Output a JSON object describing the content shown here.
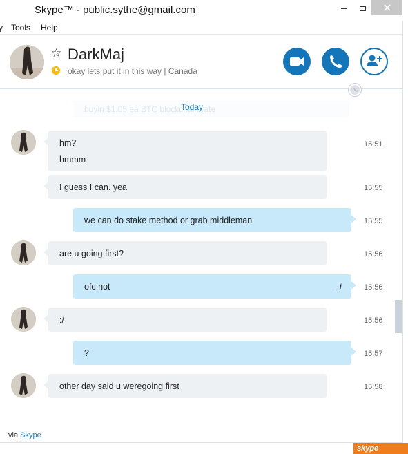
{
  "window": {
    "title": "Skype™ - public.sythe@gmail.com"
  },
  "menu": {
    "items": [
      "Tools",
      "Help"
    ]
  },
  "contact": {
    "name": "DarkMaj",
    "mood": "okay lets put it in this way",
    "location": "Canada",
    "mood_line": "okay lets put it in this way  |  Canada"
  },
  "header_buttons": {
    "video": "video-call",
    "call": "voice-call",
    "add": "add-contact"
  },
  "chat": {
    "ghost_message": "buyin $1.05 ea BTC blockchain rate",
    "date_divider": "Today",
    "messages": [
      {
        "direction": "in",
        "lines": [
          "hm?",
          "hmmm"
        ],
        "time": "15:51",
        "avatar": true
      },
      {
        "direction": "in",
        "lines": [
          "I guess I can. yea"
        ],
        "time": "15:55",
        "avatar": false
      },
      {
        "direction": "out",
        "lines": [
          "we can do stake method or grab middleman"
        ],
        "time": "15:55"
      },
      {
        "direction": "in",
        "lines": [
          "are u going first?"
        ],
        "time": "15:56",
        "avatar": true
      },
      {
        "direction": "out",
        "lines": [
          "ofc not"
        ],
        "time": "15:56",
        "edited": true
      },
      {
        "direction": "in",
        "lines": [
          ":/"
        ],
        "time": "15:56",
        "avatar": true
      },
      {
        "direction": "out",
        "lines": [
          "?"
        ],
        "time": "15:57"
      },
      {
        "direction": "in",
        "lines": [
          "other day said u weregoing first"
        ],
        "time": "15:58",
        "avatar": true
      }
    ]
  },
  "footer": {
    "via_prefix": "via",
    "via_link": "Skype",
    "badge": "skype"
  },
  "colors": {
    "accent": "#1476b9",
    "incoming_bubble": "#eef1f4",
    "outgoing_bubble": "#c7e9f9",
    "status_away": "#f8b900"
  }
}
